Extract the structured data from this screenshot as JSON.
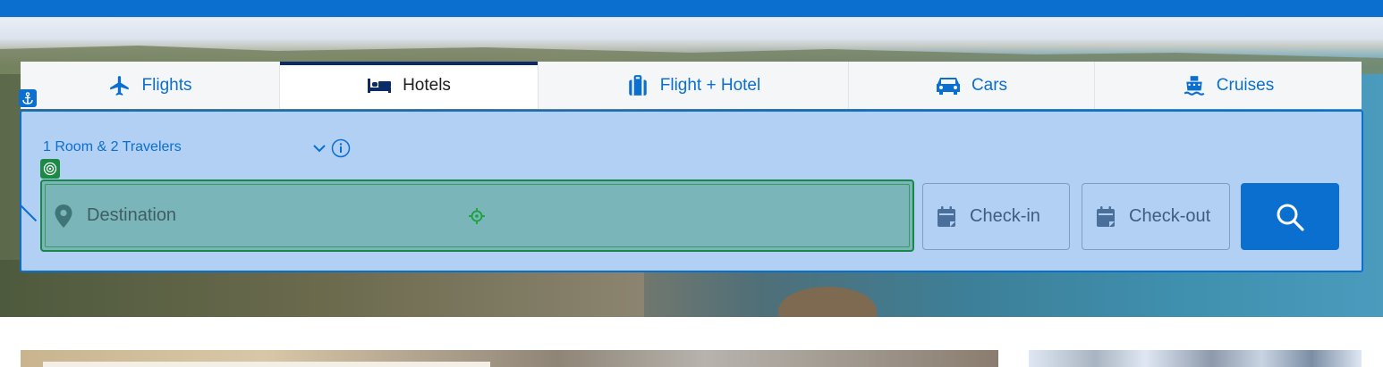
{
  "tabs": [
    {
      "label": "Flights",
      "icon": "plane-icon"
    },
    {
      "label": "Hotels",
      "icon": "bed-icon",
      "active": true
    },
    {
      "label": "Flight + Hotel",
      "icon": "luggage-icon"
    },
    {
      "label": "Cars",
      "icon": "car-icon"
    },
    {
      "label": "Cruises",
      "icon": "ship-icon"
    }
  ],
  "search": {
    "travelers": "1 Room & 2 Travelers",
    "destination_placeholder": "Destination",
    "checkin_label": "Check-in",
    "checkout_label": "Check-out"
  },
  "colors": {
    "brand_blue": "#0b6fd0",
    "panel_bg": "#b2cff4",
    "active_tab_indicator": "#0a2a68",
    "focus_green": "#18874a"
  }
}
